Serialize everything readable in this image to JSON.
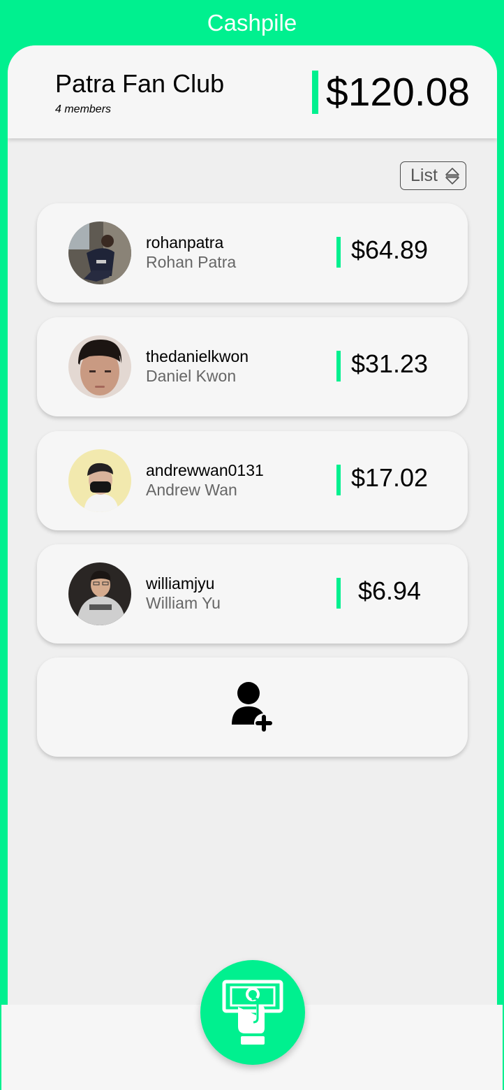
{
  "app": {
    "title": "Cashpile"
  },
  "group": {
    "name": "Patra Fan Club",
    "members_label": "4 members",
    "total": "$120.08"
  },
  "view_select": {
    "label": "List",
    "icon": "sort-arrows-icon"
  },
  "members": [
    {
      "username": "rohanpatra",
      "name": "Rohan Patra",
      "amount": "$64.89"
    },
    {
      "username": "thedanielkwon",
      "name": "Daniel Kwon",
      "amount": "$31.23"
    },
    {
      "username": "andrewwan0131",
      "name": "Andrew Wan",
      "amount": "$17.02"
    },
    {
      "username": "williamjyu",
      "name": "William Yu",
      "amount": "$6.94"
    }
  ],
  "add_member": {
    "icon": "add-user-icon"
  },
  "pay_button": {
    "icon": "cash-hand-icon"
  },
  "colors": {
    "accent": "#00F08F",
    "card": "#f6f6f6",
    "panel": "#efefef"
  }
}
